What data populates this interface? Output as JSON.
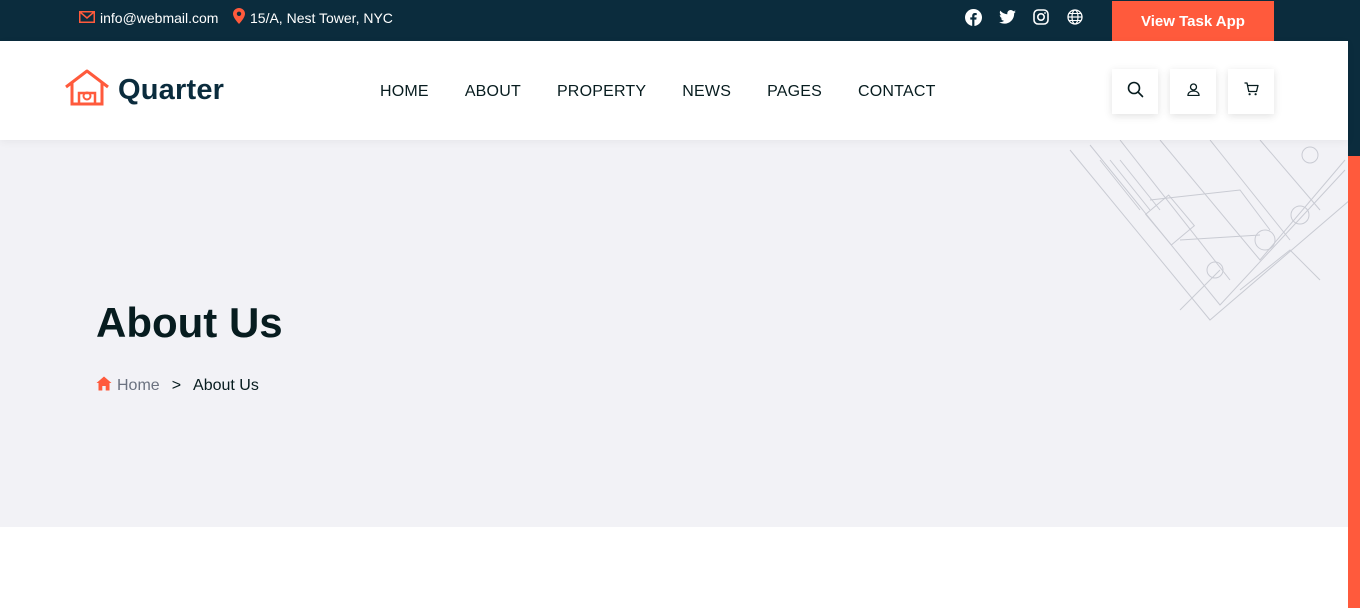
{
  "topbar": {
    "email": "info@webmail.com",
    "address": "15/A, Nest Tower, NYC",
    "socials": [
      "facebook-icon",
      "twitter-icon",
      "instagram-icon",
      "globe-icon"
    ],
    "cta_label": "View Task App"
  },
  "header": {
    "logo_text": "Quarter",
    "nav": [
      "HOME",
      "ABOUT",
      "PROPERTY",
      "NEWS",
      "PAGES",
      "CONTACT"
    ],
    "icons": [
      "search-icon",
      "user-icon",
      "cart-icon"
    ]
  },
  "hero": {
    "title": "About Us",
    "breadcrumb": {
      "home": "Home",
      "separator": ">",
      "current": "About Us"
    }
  },
  "colors": {
    "accent": "#ff5a3c",
    "dark": "#0b2c3d",
    "hero_bg": "#f2f2f6"
  }
}
